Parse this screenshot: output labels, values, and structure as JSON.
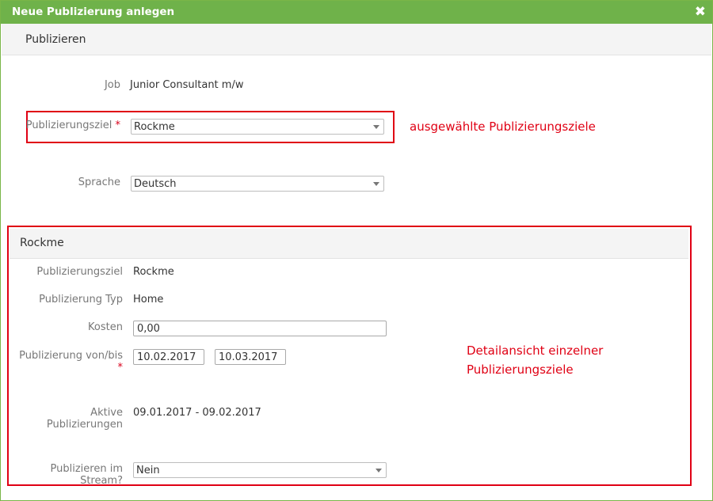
{
  "dialog": {
    "title": "Neue Publizierung anlegen",
    "close_glyph": "✖",
    "section_title": "Publizieren"
  },
  "form": {
    "job_label": "Job",
    "job_value": "Junior Consultant m/w",
    "target_label": "Publizierungsziel",
    "required_mark": "*",
    "target_value": "Rockme",
    "language_label": "Sprache",
    "language_value": "Deutsch"
  },
  "annotations": {
    "selected_targets": "ausgewählte Publizierungsziele",
    "detail_line1": "Detailansicht einzelner",
    "detail_line2": "Publizierungsziele"
  },
  "detail": {
    "title": "Rockme",
    "target_label": "Publizierungsziel",
    "target_value": "Rockme",
    "type_label": "Publizierung Typ",
    "type_value": "Home",
    "cost_label": "Kosten",
    "cost_value": "0,00",
    "period_label": "Publizierung von/bis",
    "from_value": "10.02.2017",
    "to_value": "10.03.2017",
    "active_label": "Aktive Publizierungen",
    "active_value": "09.01.2017 - 09.02.2017",
    "stream_label": "Publizieren im Stream?",
    "stream_value": "Nein"
  },
  "colors": {
    "titlebar": "#6fb24a",
    "annotation": "#e00014"
  }
}
